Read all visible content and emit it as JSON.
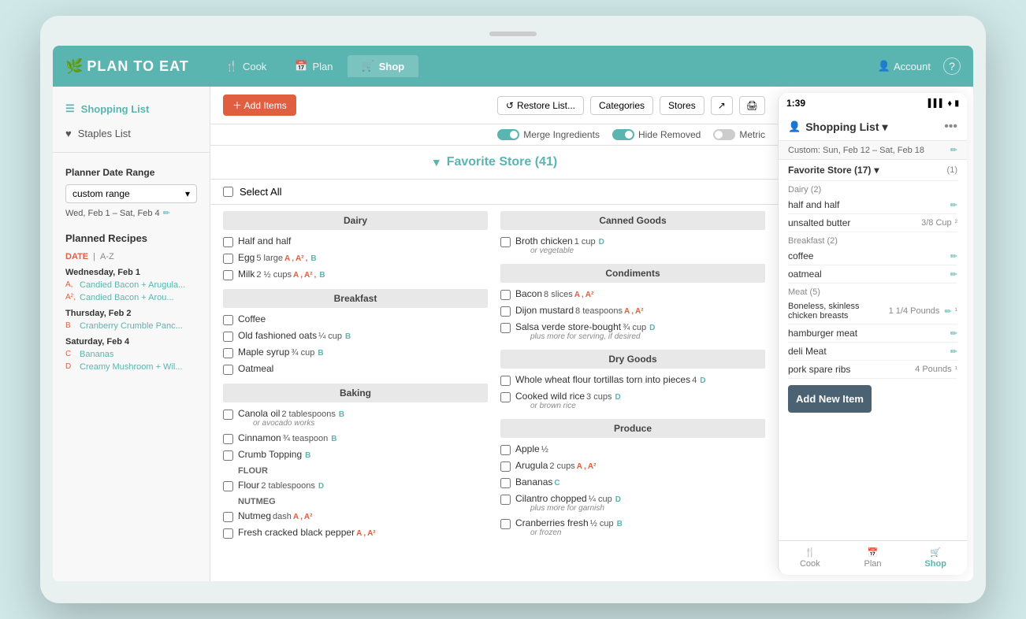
{
  "nav": {
    "logo": "PLAN TO EAT",
    "tabs": [
      {
        "label": "Cook",
        "icon": "🍴",
        "active": false
      },
      {
        "label": "Plan",
        "icon": "📅",
        "active": false
      },
      {
        "label": "Shop",
        "icon": "🛒",
        "active": true
      }
    ],
    "account": "Account",
    "help": "?"
  },
  "sidebar": {
    "shopping_list_label": "Shopping List",
    "staples_label": "Staples List",
    "date_range_title": "Planner Date Range",
    "date_range_value": "custom range",
    "date_range_dates": "Wed, Feb 1 – Sat, Feb 4",
    "planned_recipes_label": "Planned Recipes",
    "sort_date": "DATE",
    "sort_az": "A-Z",
    "recipe_dates": [
      {
        "date": "Wednesday, Feb 1",
        "recipes": [
          {
            "prefix": "A,",
            "name": "Candied Bacon + Arugula..."
          },
          {
            "prefix": "A²,",
            "name": "Candied Bacon + Arou..."
          }
        ]
      },
      {
        "date": "Thursday, Feb 2",
        "recipes": [
          {
            "prefix": "B",
            "name": "Cranberry Crumble Panc..."
          }
        ]
      },
      {
        "date": "Saturday, Feb 4",
        "recipes": [
          {
            "prefix": "c",
            "name": "Bananas"
          },
          {
            "prefix": "D",
            "name": "Creamy Mushroom + Wil..."
          }
        ]
      }
    ]
  },
  "toolbar": {
    "add_items_label": "＋ Add Items",
    "restore_label": "↺ Restore List...",
    "categories_label": "Categories",
    "stores_label": "Stores",
    "merge_ingredients_label": "Merge Ingredients",
    "hide_removed_label": "Hide Removed",
    "metric_label": "Metric",
    "select_all_label": "Select All"
  },
  "store": {
    "filter_icon": "▼",
    "name": "Favorite Store (41)"
  },
  "left_column": {
    "categories": [
      {
        "name": "Dairy",
        "items": [
          {
            "name": "Half and half",
            "qty": "",
            "tags": ""
          },
          {
            "name": "Egg",
            "qty": "5 large",
            "tags": "A, A², B"
          },
          {
            "name": "Milk",
            "qty": "2 ½ cups",
            "tags": "A, A², B"
          }
        ]
      },
      {
        "name": "Breakfast",
        "items": [
          {
            "name": "Coffee",
            "qty": "",
            "tags": ""
          },
          {
            "name": "Old fashioned oats",
            "qty": "¼ cup",
            "tags": "B"
          },
          {
            "name": "Maple syrup",
            "qty": "¾ cup",
            "tags": "B"
          },
          {
            "name": "Oatmeal",
            "qty": "",
            "tags": ""
          }
        ]
      },
      {
        "name": "Baking",
        "items": [
          {
            "name": "Canola oil",
            "qty": "2 tablespoons",
            "tags": "B",
            "note": "or avocado works"
          },
          {
            "name": "Cinnamon",
            "qty": "¾ teaspoon",
            "tags": "B"
          },
          {
            "name": "Crumb Topping",
            "qty": "",
            "tags": "B"
          },
          {
            "sublabel": "FLOUR",
            "name": "Flour",
            "qty": "2 tablespoons",
            "tags": "D"
          },
          {
            "sublabel": "NUTMEG",
            "name": "Nutmeg",
            "qty": "dash",
            "tags": "A, A²"
          },
          {
            "name": "Fresh cracked black pepper",
            "qty": "",
            "tags": "A, A²"
          }
        ]
      }
    ]
  },
  "right_column": {
    "categories": [
      {
        "name": "Canned Goods",
        "items": [
          {
            "name": "Broth chicken",
            "qty": "1 cup",
            "tags": "D",
            "note": "or vegetable"
          }
        ]
      },
      {
        "name": "Condiments",
        "items": [
          {
            "name": "Bacon",
            "qty": "8 slices",
            "tags": "A, A²"
          },
          {
            "name": "Dijon mustard",
            "qty": "8 teaspoons",
            "tags": "A, A²"
          },
          {
            "name": "Salsa verde store-bought",
            "qty": "¾ cup",
            "tags": "D",
            "note": "plus more for serving, if desired"
          }
        ]
      },
      {
        "name": "Dry Goods",
        "items": [
          {
            "name": "Whole wheat flour tortillas torn into pieces",
            "qty": "4",
            "tags": "D"
          },
          {
            "name": "Cooked wild rice",
            "qty": "3 cups",
            "tags": "D",
            "note": "or brown rice"
          }
        ]
      },
      {
        "name": "Produce",
        "items": [
          {
            "name": "Apple",
            "qty": "½",
            "tags": ""
          },
          {
            "name": "Arugula",
            "qty": "2 cups",
            "tags": "A, A²"
          },
          {
            "name": "Bananas",
            "qty": "",
            "tags": "C"
          },
          {
            "name": "Cilantro chopped",
            "qty": "¼ cup",
            "tags": "D",
            "note": "plus more for garnish"
          },
          {
            "name": "Cranberries fresh",
            "qty": "½ cup",
            "tags": "B",
            "note": "or frozen"
          }
        ]
      }
    ]
  },
  "mobile": {
    "time": "1:39",
    "title": "Shopping List",
    "title_arrow": "▼",
    "date_range": "Custom: Sun, Feb 12 – Sat, Feb 18",
    "store_name": "Favorite Store (17)",
    "store_count": "(1)",
    "categories": [
      {
        "name": "Dairy (2)",
        "items": [
          {
            "name": "half and half",
            "qty": "",
            "has_edit": true
          },
          {
            "name": "unsalted butter",
            "qty": "3/8 Cup",
            "has_edit": false,
            "badge": "2"
          }
        ]
      },
      {
        "name": "Breakfast (2)",
        "items": [
          {
            "name": "coffee",
            "qty": "",
            "has_edit": true
          },
          {
            "name": "oatmeal",
            "qty": "",
            "has_edit": true
          }
        ]
      },
      {
        "name": "Meat (5)",
        "items": [
          {
            "name": "Boneless, skinless chicken breasts",
            "qty": "1 1/4 Pounds",
            "has_edit": true,
            "badge": "1"
          },
          {
            "name": "hamburger meat",
            "qty": "",
            "has_edit": true
          },
          {
            "name": "deli Meat",
            "qty": "",
            "has_edit": true
          },
          {
            "name": "pork spare ribs",
            "qty": "4 Pounds",
            "has_edit": false,
            "badge": "1"
          }
        ]
      }
    ],
    "add_new_item": "Add New Item",
    "bottom_nav": [
      {
        "label": "Cook",
        "icon": "🍴",
        "active": false
      },
      {
        "label": "Plan",
        "icon": "📅",
        "active": false
      },
      {
        "label": "Shop",
        "icon": "🛒",
        "active": true
      }
    ]
  }
}
